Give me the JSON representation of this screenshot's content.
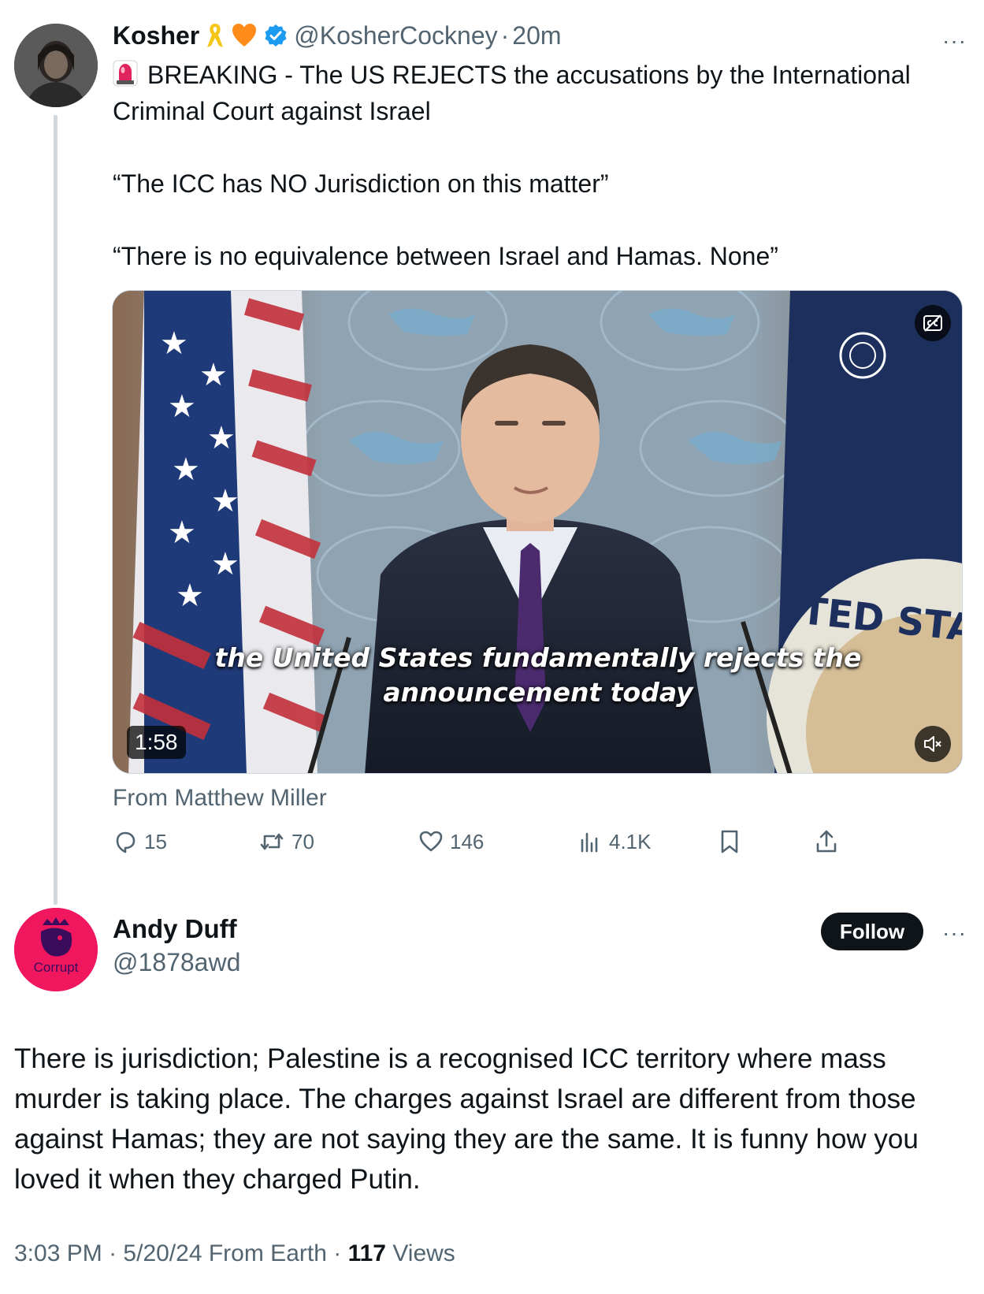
{
  "tweet": {
    "author_name": "Kosher",
    "author_handle": "@KosherCockney",
    "separator": "·",
    "time": "20m",
    "more": "···",
    "lines": [
      "BREAKING - The US REJECTS the accusations by the International Criminal Court against Israel",
      "“The ICC has NO Jurisdiction on this matter”",
      "“There is no equivalence between Israel and Hamas. None”"
    ],
    "video": {
      "caption_line1": "the United States fundamentally rejects the",
      "caption_line2": "announcement today",
      "duration": "1:58",
      "seal_text": "ITED STA"
    },
    "attribution": "From Matthew Miller",
    "stats": {
      "replies": "15",
      "reposts": "70",
      "likes": "146",
      "views": "4.1K"
    }
  },
  "reply": {
    "author_name": "Andy Duff",
    "author_handle": "@1878awd",
    "avatar_text": "Corrupt",
    "follow_label": "Follow",
    "more": "···",
    "body": "There is jurisdiction; Palestine is a recognised ICC territory where mass murder is taking place. The charges against Israel are different from those against Hamas; they are not saying they are the same. It is funny how you loved it when they charged Putin.",
    "time": "3:03 PM",
    "date": "5/20/24",
    "source": "From Earth",
    "separator": "·",
    "views_count": "117",
    "views_label": "Views"
  },
  "colors": {
    "text_primary": "#0f1419",
    "text_secondary": "#536471",
    "verified_blue": "#1d9bf0",
    "reply_avatar_bg": "#f0175f",
    "follow_bg": "#0f1419"
  },
  "icons": [
    "siren-icon",
    "ribbon-icon",
    "heart-icon",
    "verified-icon",
    "reply-icon",
    "repost-icon",
    "like-icon",
    "views-icon",
    "bookmark-icon",
    "share-icon",
    "captions-icon",
    "mute-icon"
  ]
}
